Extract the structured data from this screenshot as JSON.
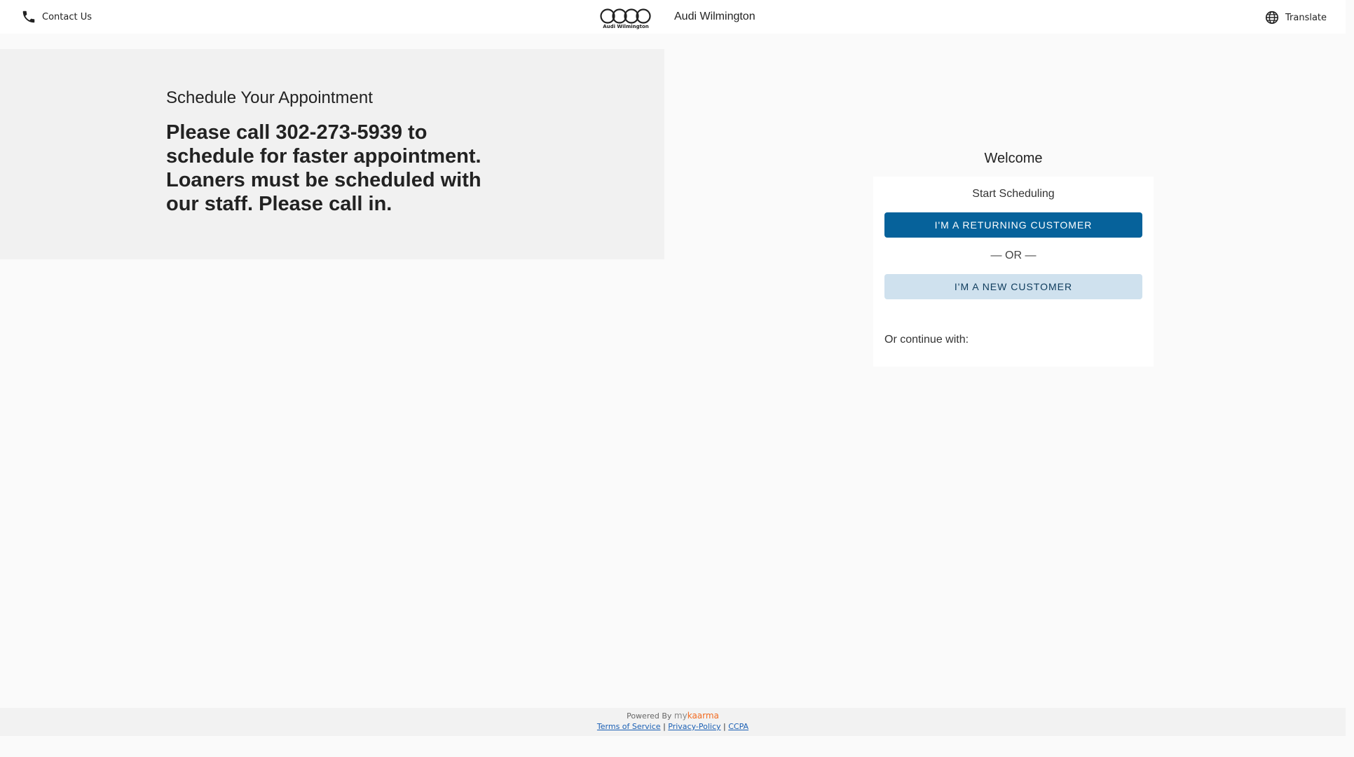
{
  "header": {
    "contact_label": "Contact Us",
    "logo_text": "Audi Wilmington",
    "dealer_name": "Audi Wilmington",
    "translate_label": "Translate"
  },
  "promo": {
    "title": "Schedule Your Appointment",
    "body": "Please call 302-273-5939 to schedule for faster appointment. Loaners must be scheduled with our staff. Please call in."
  },
  "scheduling": {
    "welcome": "Welcome",
    "start_label": "Start Scheduling",
    "returning_button": "I'm a Returning Customer",
    "or_divider": "— OR —",
    "new_button": "I'm a New Customer",
    "continue_label": "Or continue with:"
  },
  "footer": {
    "powered_by": "Powered By",
    "brand_my": "my",
    "brand_name": "kaarma",
    "links": [
      "Terms of Service",
      "Privacy-Policy",
      "CCPA"
    ],
    "separator": "|"
  },
  "colors": {
    "primary_button": "#06629b",
    "secondary_button": "#cfe1ee",
    "link": "#1a5fb4"
  },
  "icons": {
    "contact": "phone-icon",
    "translate": "globe-icon",
    "logo": "audi-rings-logo"
  }
}
